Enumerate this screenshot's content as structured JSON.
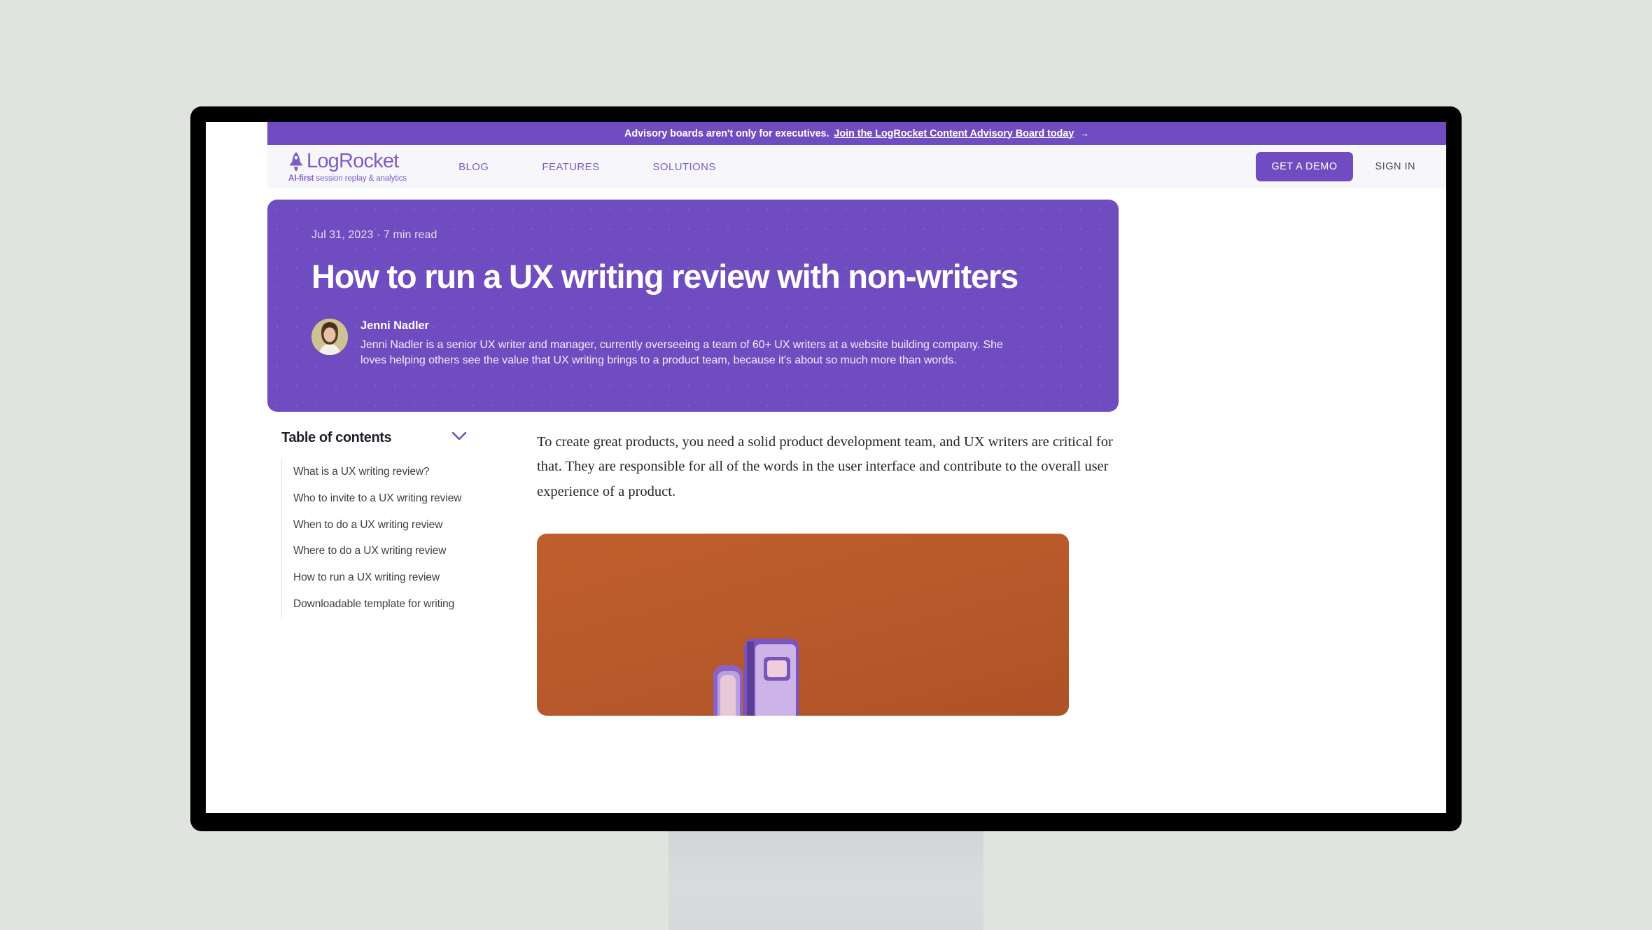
{
  "banner": {
    "text": "Advisory boards aren't only for executives.",
    "link_text": "Join the LogRocket Content Advisory Board today",
    "arrow": "→"
  },
  "header": {
    "logo_word": "LogRocket",
    "logo_tagline_bold": "AI-first",
    "logo_tagline_rest": " session replay & analytics",
    "nav": [
      {
        "label": "BLOG"
      },
      {
        "label": "FEATURES"
      },
      {
        "label": "SOLUTIONS"
      }
    ],
    "demo_button": "GET A DEMO",
    "signin_button": "SIGN IN"
  },
  "hero": {
    "date": "Jul 31, 2023",
    "separator": "·",
    "read_time": "7 min read",
    "meta": "Jul 31, 2023 · 7 min read",
    "title": "How to run a UX writing review with non-writers",
    "author_name": "Jenni Nadler",
    "author_bio": "Jenni Nadler is a senior UX writer and manager, currently overseeing a team of 60+ UX writers at a website building company. She loves helping others see the value that UX writing brings to a product team, because it's about so much more than words.",
    "background_color": "#6f4cbf"
  },
  "toc": {
    "title": "Table of contents",
    "items": [
      {
        "label": "What is a UX writing review?"
      },
      {
        "label": "Who to invite to a UX writing review"
      },
      {
        "label": "When to do a UX writing review"
      },
      {
        "label": "Where to do a UX writing review"
      },
      {
        "label": "How to run a UX writing review"
      },
      {
        "label": "Downloadable template for writing"
      }
    ]
  },
  "article": {
    "paragraph_1": "To create great products, you need a solid product development team, and UX writers are critical for that. They are responsible for all of the words in the user interface and contribute to the overall user experience of a product."
  },
  "colors": {
    "brand_purple": "#6f4cbf",
    "nav_purple": "#7d5cc6",
    "page_background": "#dfe4df",
    "header_background": "#f7f7fb",
    "figure_orange": "#b85a2a"
  }
}
